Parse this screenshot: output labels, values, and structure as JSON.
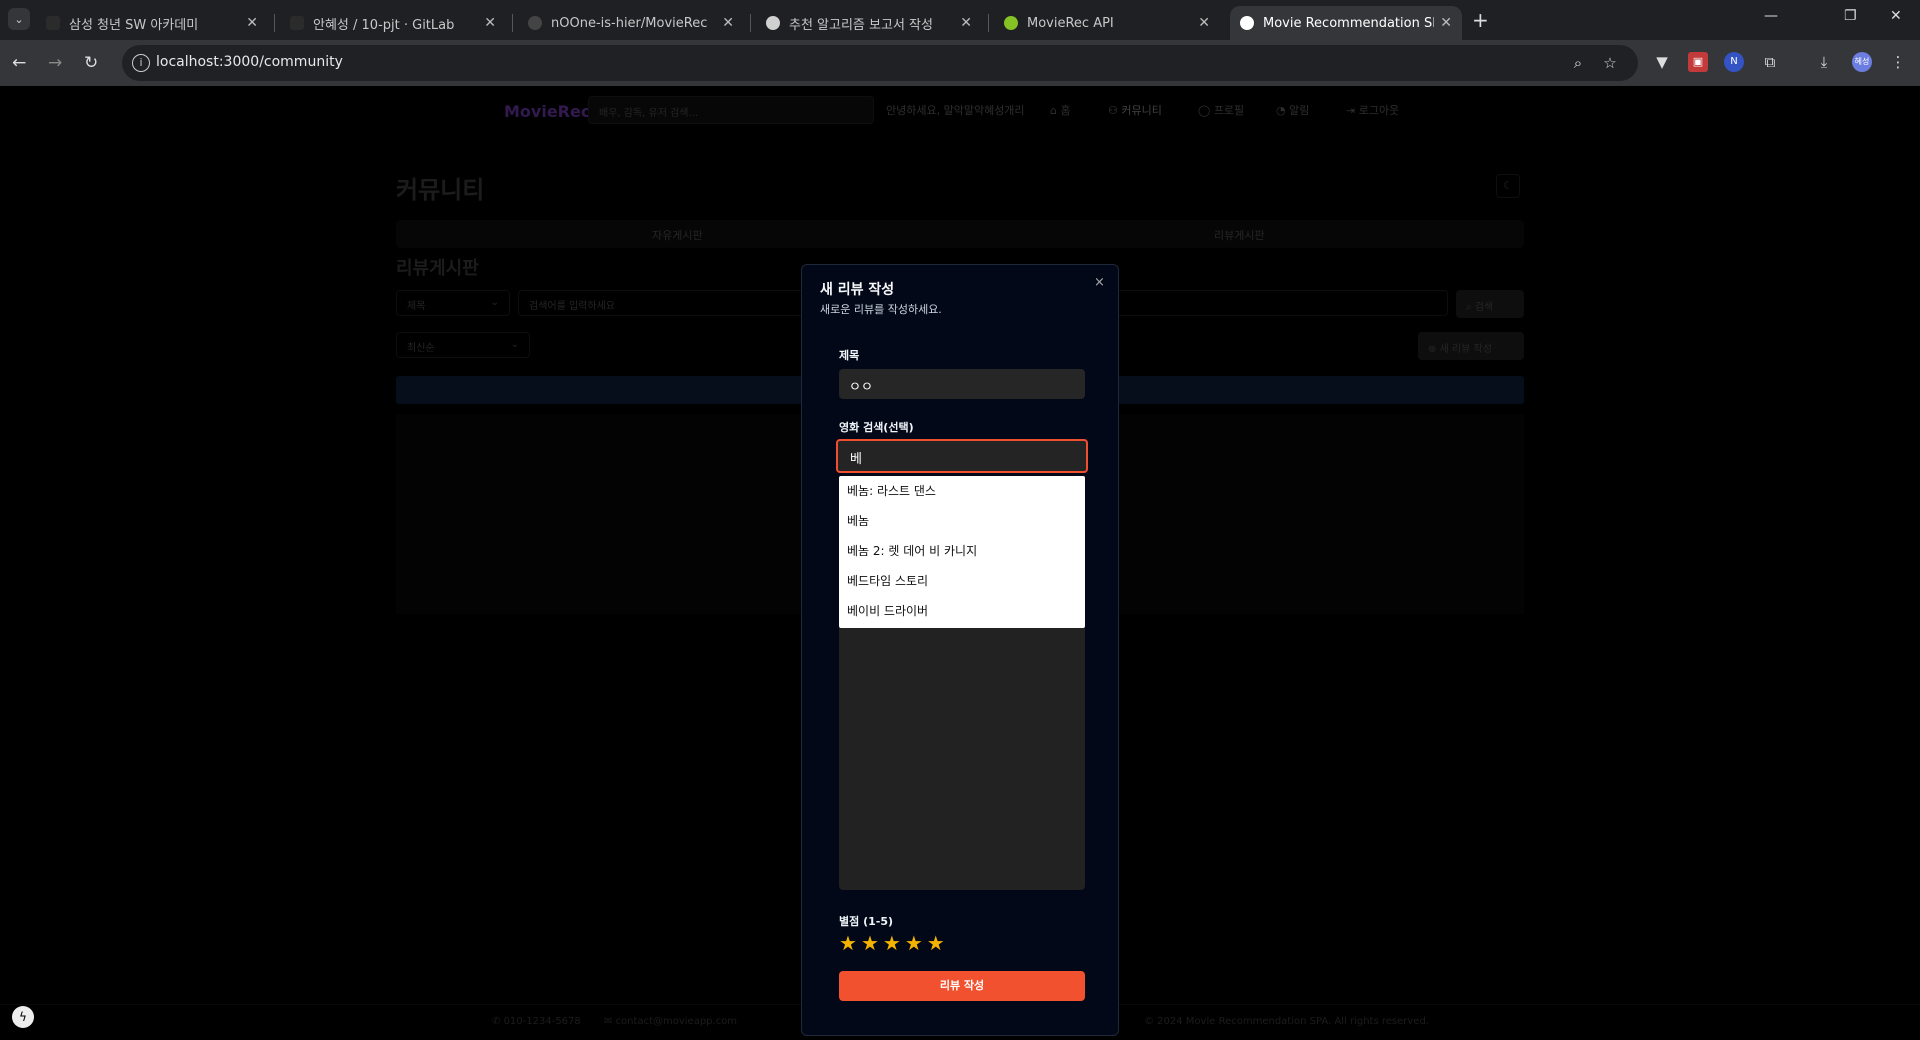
{
  "browser": {
    "tabs": [
      {
        "title": "삼성 청년 SW 아카데미",
        "favicon_color": "#2b2b2b"
      },
      {
        "title": "안혜성 / 10-pjt · GitLab",
        "favicon_color": "#2b2b2b"
      },
      {
        "title": "nOOne-is-hier/MovieRec",
        "favicon_color": "#444444"
      },
      {
        "title": "추천 알고리즘 보고서 작성",
        "favicon_color": "#d0d0d0"
      },
      {
        "title": "MovieRec API",
        "favicon_color": "#85c226"
      },
      {
        "title": "Movie Recommendation SPA",
        "favicon_color": "#ffffff"
      }
    ],
    "url": "localhost:3000/community",
    "profile_initials": "혜성"
  },
  "site": {
    "logo": "MovieRec",
    "search_placeholder": "배우, 감독, 유저 검색...",
    "greeting": "안녕하세요, 말악말악혜성개리",
    "nav": [
      "홈",
      "커뮤니티",
      "프로필",
      "알림",
      "로그아웃"
    ]
  },
  "community": {
    "title": "커뮤니티",
    "tabs": [
      "자유게시판",
      "리뷰게시판"
    ],
    "board_title": "리뷰게시판",
    "filter_select": "제목",
    "search_placeholder": "검색어를 입력하세요",
    "search_button": "검색",
    "sort_select": "최신순",
    "new_review_button": "새 리뷰 작성"
  },
  "modal": {
    "title": "새 리뷰 작성",
    "subtitle": "새로운 리뷰를 작성하세요.",
    "close": "×",
    "title_label": "제목",
    "title_value": "ㅇㅇ",
    "movie_label": "영화 검색(선택)",
    "movie_value": "베",
    "suggestions": [
      "베놈: 라스트 댄스",
      "베놈",
      "베놈 2: 렛 데어 비 카니지",
      "베드타임 스토리",
      "베이비 드라이버"
    ],
    "rating_label": "별점 (1-5)",
    "rating": 5,
    "submit": "리뷰 작성"
  },
  "footer": {
    "phone": "010-1234-5678",
    "email": "contact@movieapp.com",
    "copyright": "© 2024 Movie Recommendation SPA. All rights reserved."
  }
}
